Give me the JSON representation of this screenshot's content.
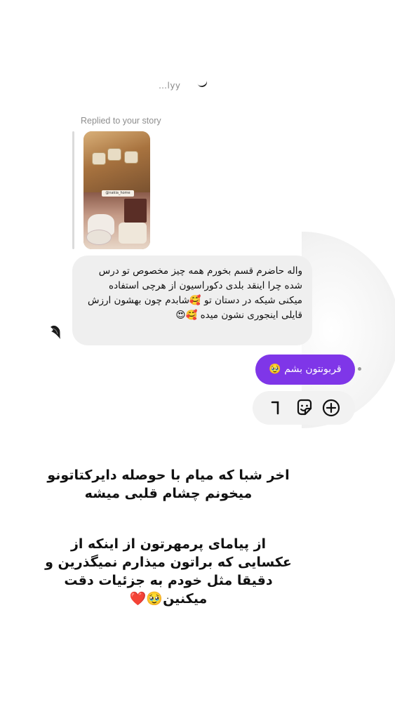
{
  "thread": {
    "top_name": "…lyy",
    "replied_label": "Replied to your story",
    "story_tag": "@nakia_home"
  },
  "received_message": {
    "text": "واله حاضرم قسم بخورم همه چیز مخصوص تو درس شده چرا اینقد بلدی دکوراسیون از هرچی استفاده میکنی شیکه در دستان تو 🥰شابدم چون بهشون ارزش قایلی اینجوری نشون میده 🥰😍"
  },
  "sent_message": {
    "text": "قربونتون بشم 🥹"
  },
  "toolbar": {
    "icons": [
      "add-icon",
      "sticker-icon",
      "partial-icon"
    ]
  },
  "caption": {
    "paragraph1": "اخر شبا که میام با حوصله دایرکتاتونو میخونم چشام قلبی میشه",
    "paragraph2": "از پیامای پرمهرتون از اینکه از عکسایی که براتون میذارم نمیگذرین و دقیقا مثل خودم به جزئیات دقت میکنین🥹❤️"
  },
  "colors": {
    "sent_bubble": "#7f36e8",
    "received_bubble": "#efefef",
    "meta_text": "#8e8e8e"
  }
}
